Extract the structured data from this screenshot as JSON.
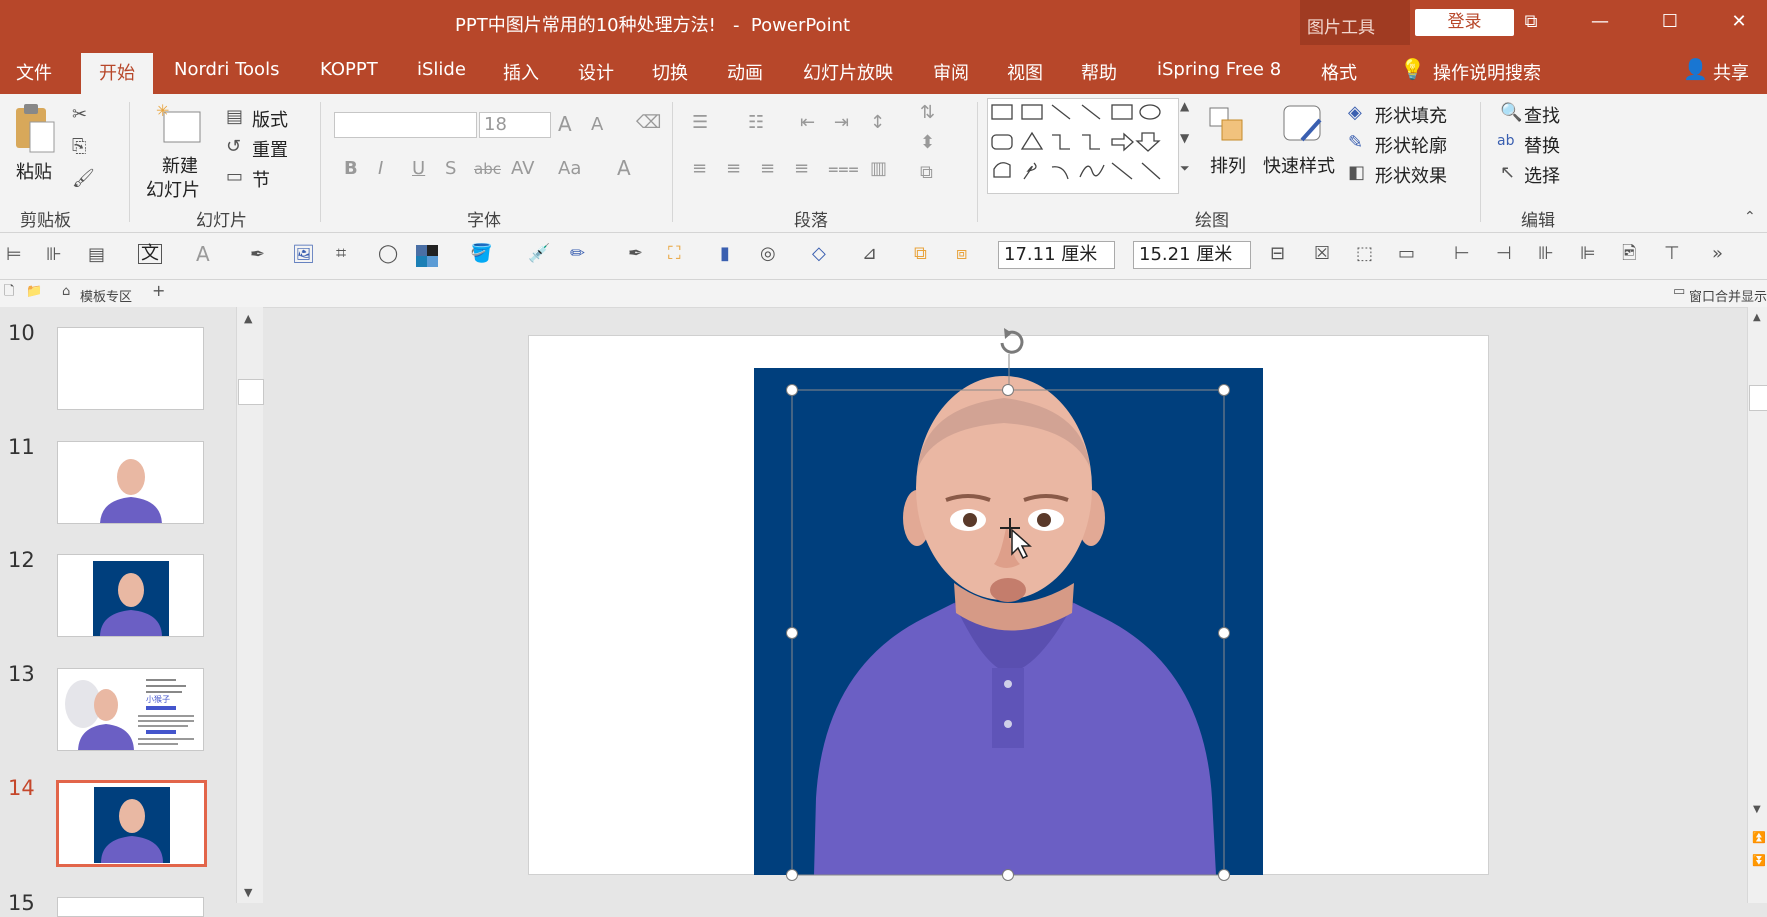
{
  "window": {
    "title": "PPT中图片常用的10种处理方法!   -  PowerPoint",
    "context_tools_label": "图片工具",
    "login_label": "登录",
    "controls": {
      "ribbon_display": "⧉",
      "minimize": "—",
      "maximize": "☐",
      "close": "✕"
    }
  },
  "tabs": [
    "文件",
    "开始",
    "Nordri Tools",
    "KOPPT",
    "iSlide",
    "插入",
    "设计",
    "切换",
    "动画",
    "幻灯片放映",
    "审阅",
    "视图",
    "帮助",
    "iSpring Free 8",
    "格式"
  ],
  "active_tab": "开始",
  "search_hint": "操作说明搜索",
  "share_label": "共享",
  "ribbon": {
    "clipboard": {
      "paste": "粘贴",
      "label": "剪贴板"
    },
    "slides": {
      "new_line1": "新建",
      "new_line2": "幻灯片",
      "layout": "版式",
      "reset": "重置",
      "section": "节",
      "label": "幻灯片"
    },
    "font": {
      "font_name": "",
      "font_size": "18",
      "label": "字体"
    },
    "paragraph": {
      "label": "段落"
    },
    "drawing": {
      "arrange": "排列",
      "quick_styles": "快速样式",
      "fill": "形状填充",
      "outline": "形状轮廓",
      "effects": "形状效果",
      "label": "绘图"
    },
    "editing": {
      "find": "查找",
      "replace": "替换",
      "select": "选择",
      "label": "编辑"
    }
  },
  "quick_toolbar": {
    "text_glyph": "文",
    "height": "17.11 厘米",
    "width": "15.21 厘米"
  },
  "tab_bar": {
    "template_zone": "模板专区",
    "merge_windows": "窗口合并显示"
  },
  "slides": [
    {
      "num": "10"
    },
    {
      "num": "11"
    },
    {
      "num": "12"
    },
    {
      "num": "13"
    },
    {
      "num": "14"
    },
    {
      "num": "15"
    }
  ],
  "active_slide": "14",
  "slide13_logo": "小猴子",
  "colors": {
    "accent": "#b7472a",
    "photo_bg": "#003f7d",
    "shirt": "#6b5fc4"
  }
}
